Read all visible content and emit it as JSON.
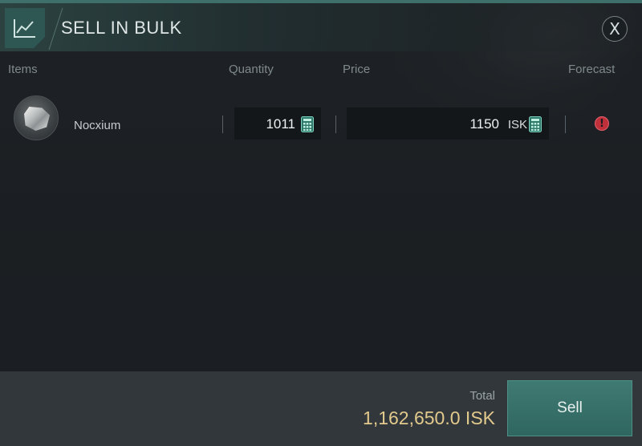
{
  "window": {
    "title": "SELL IN BULK",
    "close_label": "X",
    "header_icon": "chart-line-icon"
  },
  "columns": {
    "items": "Items",
    "quantity": "Quantity",
    "price": "Price",
    "forecast": "Forecast"
  },
  "rows": [
    {
      "name": "Nocxium",
      "quantity": "1011",
      "price": "1150",
      "price_unit": "ISK",
      "forecast_status": "!",
      "forecast_icon": "warning-icon"
    }
  ],
  "footer": {
    "total_label": "Total",
    "total_value": "1,162,650.0 ISK",
    "sell_label": "Sell"
  },
  "colors": {
    "accent": "#3f7a72",
    "total_text": "#e2c98c",
    "warning": "#c0303b"
  }
}
